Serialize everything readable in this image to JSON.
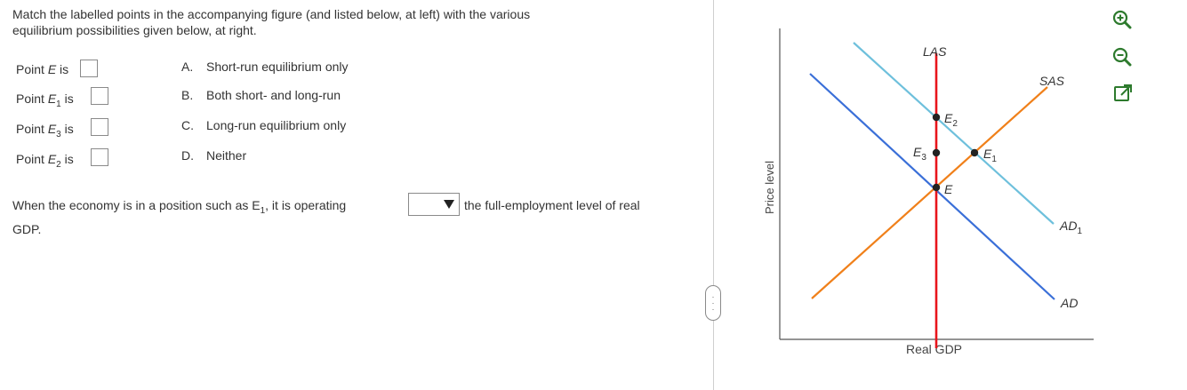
{
  "prompt": {
    "line1": "Match the labelled points in the accompanying figure (and listed below, at left) with the various",
    "line2": "equilibrium possibilities given below, at right."
  },
  "rows": [
    {
      "prefix": "Point ",
      "name": "E",
      "sub": "",
      "suffix": " is"
    },
    {
      "prefix": "Point ",
      "name": "E",
      "sub": "1",
      "suffix": " is"
    },
    {
      "prefix": "Point ",
      "name": "E",
      "sub": "3",
      "suffix": " is"
    },
    {
      "prefix": "Point ",
      "name": "E",
      "sub": "2",
      "suffix": " is"
    }
  ],
  "choices": [
    {
      "letter": "A.",
      "text": "Short-run equilibrium only"
    },
    {
      "letter": "B.",
      "text": "Both short- and long-run"
    },
    {
      "letter": "C.",
      "text": "Long-run equilibrium only"
    },
    {
      "letter": "D.",
      "text": "Neither"
    }
  ],
  "question2": {
    "before": "When the economy is in a position such as E",
    "sub": "1",
    "after": ", it is operating",
    "dropdown_value": "",
    "after_dropdown": "the full-employment level of real",
    "continuation": "GDP."
  },
  "graph": {
    "xlabel": "Real GDP",
    "ylabel": "Price level",
    "curves": {
      "las": "LAS",
      "sas": "SAS",
      "ad1_main": "AD",
      "ad1_sub": "1",
      "ad": "AD"
    },
    "points": {
      "e": "E",
      "e2_main": "E",
      "e2_sub": "2",
      "e3_main": "E",
      "e3_sub": "3",
      "e1_main": "E",
      "e1_sub": "1"
    },
    "colors": {
      "las": "#e8141b",
      "sas": "#f0801a",
      "ad1": "#6ec0dc",
      "ad": "#3a6fd8",
      "axis": "#555555"
    }
  },
  "toolbar": {
    "zoom_in": "zoom-in-icon",
    "zoom_out": "zoom-out-icon",
    "popout": "popout-icon"
  }
}
